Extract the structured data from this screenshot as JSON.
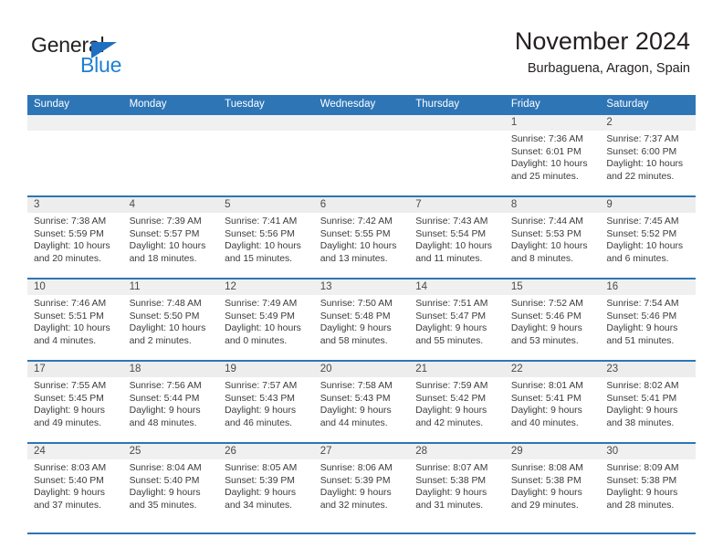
{
  "brand": {
    "name_dark": "General",
    "name_light": "Blue",
    "accent_color": "#2e75b6",
    "logo_icon": "triangle-icon"
  },
  "header": {
    "title": "November 2024",
    "subtitle": "Burbaguena, Aragon, Spain"
  },
  "calendar": {
    "weekday_headers": [
      "Sunday",
      "Monday",
      "Tuesday",
      "Wednesday",
      "Thursday",
      "Friday",
      "Saturday"
    ],
    "weeks": [
      [
        {
          "day": "",
          "empty": true,
          "lines": []
        },
        {
          "day": "",
          "empty": true,
          "lines": []
        },
        {
          "day": "",
          "empty": true,
          "lines": []
        },
        {
          "day": "",
          "empty": true,
          "lines": []
        },
        {
          "day": "",
          "empty": true,
          "lines": []
        },
        {
          "day": "1",
          "empty": false,
          "lines": [
            "Sunrise: 7:36 AM",
            "Sunset: 6:01 PM",
            "Daylight: 10 hours",
            "and 25 minutes."
          ]
        },
        {
          "day": "2",
          "empty": false,
          "lines": [
            "Sunrise: 7:37 AM",
            "Sunset: 6:00 PM",
            "Daylight: 10 hours",
            "and 22 minutes."
          ]
        }
      ],
      [
        {
          "day": "3",
          "empty": false,
          "lines": [
            "Sunrise: 7:38 AM",
            "Sunset: 5:59 PM",
            "Daylight: 10 hours",
            "and 20 minutes."
          ]
        },
        {
          "day": "4",
          "empty": false,
          "lines": [
            "Sunrise: 7:39 AM",
            "Sunset: 5:57 PM",
            "Daylight: 10 hours",
            "and 18 minutes."
          ]
        },
        {
          "day": "5",
          "empty": false,
          "lines": [
            "Sunrise: 7:41 AM",
            "Sunset: 5:56 PM",
            "Daylight: 10 hours",
            "and 15 minutes."
          ]
        },
        {
          "day": "6",
          "empty": false,
          "lines": [
            "Sunrise: 7:42 AM",
            "Sunset: 5:55 PM",
            "Daylight: 10 hours",
            "and 13 minutes."
          ]
        },
        {
          "day": "7",
          "empty": false,
          "lines": [
            "Sunrise: 7:43 AM",
            "Sunset: 5:54 PM",
            "Daylight: 10 hours",
            "and 11 minutes."
          ]
        },
        {
          "day": "8",
          "empty": false,
          "lines": [
            "Sunrise: 7:44 AM",
            "Sunset: 5:53 PM",
            "Daylight: 10 hours",
            "and 8 minutes."
          ]
        },
        {
          "day": "9",
          "empty": false,
          "lines": [
            "Sunrise: 7:45 AM",
            "Sunset: 5:52 PM",
            "Daylight: 10 hours",
            "and 6 minutes."
          ]
        }
      ],
      [
        {
          "day": "10",
          "empty": false,
          "lines": [
            "Sunrise: 7:46 AM",
            "Sunset: 5:51 PM",
            "Daylight: 10 hours",
            "and 4 minutes."
          ]
        },
        {
          "day": "11",
          "empty": false,
          "lines": [
            "Sunrise: 7:48 AM",
            "Sunset: 5:50 PM",
            "Daylight: 10 hours",
            "and 2 minutes."
          ]
        },
        {
          "day": "12",
          "empty": false,
          "lines": [
            "Sunrise: 7:49 AM",
            "Sunset: 5:49 PM",
            "Daylight: 10 hours",
            "and 0 minutes."
          ]
        },
        {
          "day": "13",
          "empty": false,
          "lines": [
            "Sunrise: 7:50 AM",
            "Sunset: 5:48 PM",
            "Daylight: 9 hours",
            "and 58 minutes."
          ]
        },
        {
          "day": "14",
          "empty": false,
          "lines": [
            "Sunrise: 7:51 AM",
            "Sunset: 5:47 PM",
            "Daylight: 9 hours",
            "and 55 minutes."
          ]
        },
        {
          "day": "15",
          "empty": false,
          "lines": [
            "Sunrise: 7:52 AM",
            "Sunset: 5:46 PM",
            "Daylight: 9 hours",
            "and 53 minutes."
          ]
        },
        {
          "day": "16",
          "empty": false,
          "lines": [
            "Sunrise: 7:54 AM",
            "Sunset: 5:46 PM",
            "Daylight: 9 hours",
            "and 51 minutes."
          ]
        }
      ],
      [
        {
          "day": "17",
          "empty": false,
          "lines": [
            "Sunrise: 7:55 AM",
            "Sunset: 5:45 PM",
            "Daylight: 9 hours",
            "and 49 minutes."
          ]
        },
        {
          "day": "18",
          "empty": false,
          "lines": [
            "Sunrise: 7:56 AM",
            "Sunset: 5:44 PM",
            "Daylight: 9 hours",
            "and 48 minutes."
          ]
        },
        {
          "day": "19",
          "empty": false,
          "lines": [
            "Sunrise: 7:57 AM",
            "Sunset: 5:43 PM",
            "Daylight: 9 hours",
            "and 46 minutes."
          ]
        },
        {
          "day": "20",
          "empty": false,
          "lines": [
            "Sunrise: 7:58 AM",
            "Sunset: 5:43 PM",
            "Daylight: 9 hours",
            "and 44 minutes."
          ]
        },
        {
          "day": "21",
          "empty": false,
          "lines": [
            "Sunrise: 7:59 AM",
            "Sunset: 5:42 PM",
            "Daylight: 9 hours",
            "and 42 minutes."
          ]
        },
        {
          "day": "22",
          "empty": false,
          "lines": [
            "Sunrise: 8:01 AM",
            "Sunset: 5:41 PM",
            "Daylight: 9 hours",
            "and 40 minutes."
          ]
        },
        {
          "day": "23",
          "empty": false,
          "lines": [
            "Sunrise: 8:02 AM",
            "Sunset: 5:41 PM",
            "Daylight: 9 hours",
            "and 38 minutes."
          ]
        }
      ],
      [
        {
          "day": "24",
          "empty": false,
          "lines": [
            "Sunrise: 8:03 AM",
            "Sunset: 5:40 PM",
            "Daylight: 9 hours",
            "and 37 minutes."
          ]
        },
        {
          "day": "25",
          "empty": false,
          "lines": [
            "Sunrise: 8:04 AM",
            "Sunset: 5:40 PM",
            "Daylight: 9 hours",
            "and 35 minutes."
          ]
        },
        {
          "day": "26",
          "empty": false,
          "lines": [
            "Sunrise: 8:05 AM",
            "Sunset: 5:39 PM",
            "Daylight: 9 hours",
            "and 34 minutes."
          ]
        },
        {
          "day": "27",
          "empty": false,
          "lines": [
            "Sunrise: 8:06 AM",
            "Sunset: 5:39 PM",
            "Daylight: 9 hours",
            "and 32 minutes."
          ]
        },
        {
          "day": "28",
          "empty": false,
          "lines": [
            "Sunrise: 8:07 AM",
            "Sunset: 5:38 PM",
            "Daylight: 9 hours",
            "and 31 minutes."
          ]
        },
        {
          "day": "29",
          "empty": false,
          "lines": [
            "Sunrise: 8:08 AM",
            "Sunset: 5:38 PM",
            "Daylight: 9 hours",
            "and 29 minutes."
          ]
        },
        {
          "day": "30",
          "empty": false,
          "lines": [
            "Sunrise: 8:09 AM",
            "Sunset: 5:38 PM",
            "Daylight: 9 hours",
            "and 28 minutes."
          ]
        }
      ]
    ]
  }
}
